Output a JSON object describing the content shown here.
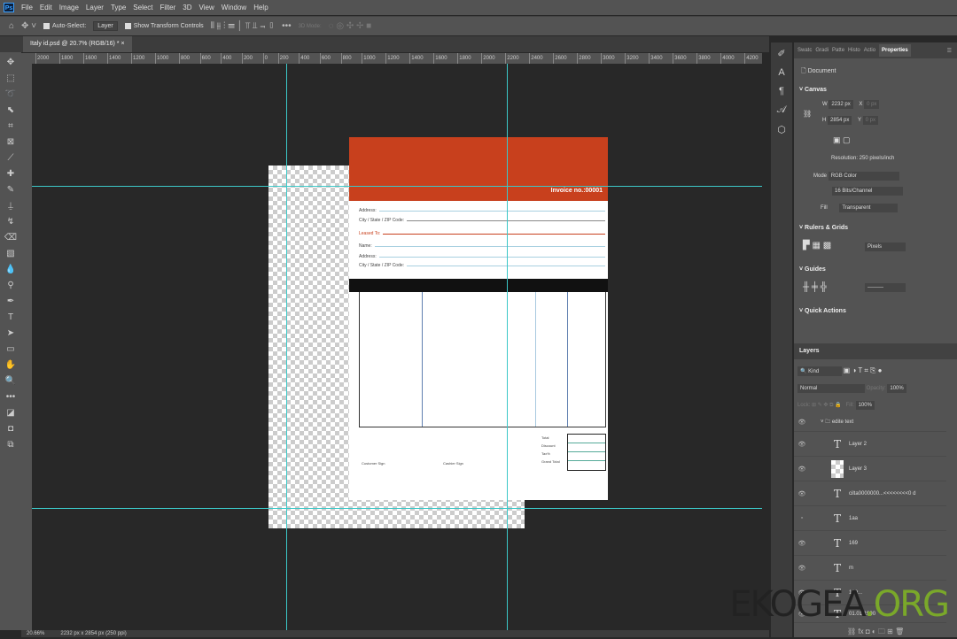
{
  "menu": [
    "File",
    "Edit",
    "Image",
    "Layer",
    "Type",
    "Select",
    "Filter",
    "3D",
    "View",
    "Window",
    "Help"
  ],
  "options": {
    "auto_select": "Auto-Select:",
    "layer_select": "Layer",
    "show_transform": "Show Transform Controls",
    "mode_3d": "3D Mode:"
  },
  "tab": {
    "title": "Italy id.psd @ 20.7% (RGB/16) *",
    "close": "×"
  },
  "ruler_ticks": [
    "2000",
    "1800",
    "1600",
    "1400",
    "1200",
    "1000",
    "800",
    "600",
    "400",
    "200",
    "0",
    "200",
    "400",
    "600",
    "800",
    "1000",
    "1200",
    "1400",
    "1600",
    "1800",
    "2000",
    "2200",
    "2400",
    "2600",
    "2800",
    "3000",
    "3200",
    "3400",
    "3600",
    "3800",
    "4000",
    "4200"
  ],
  "document": {
    "invoice_no": "Invoice no.:00001",
    "address": "Address:",
    "city": "City / State / ZIP Code:",
    "leased_to": "Leased To:",
    "name": "Name:",
    "address2": "Address:",
    "city2": "City / State / ZIP Code:",
    "total": "Total",
    "discount": "Discount",
    "tax": "Tax%",
    "grand_total": "Grand Total",
    "customer_sign": "Customer Sign",
    "cashier_sign": "Cashier Sign",
    "header_color": "#c8401d"
  },
  "status": {
    "zoom": "20.66%",
    "info": "2232 px x 2854 px (250 ppi)"
  },
  "panel": {
    "tabs": [
      "Swatc",
      "Gradi",
      "Patte",
      "Histo",
      "Actio",
      "Properties"
    ],
    "document": "Document",
    "canvas": "Canvas",
    "w_label": "W",
    "w": "2232 px",
    "h_label": "H",
    "h": "2854 px",
    "x_label": "X",
    "x": "0 px",
    "y_label": "Y",
    "y": "0 px",
    "resolution": "Resolution: 250 pixels/inch",
    "mode_label": "Mode",
    "mode": "RGB Color",
    "depth": "16 Bits/Channel",
    "fill_label": "Fill",
    "fill": "Transparent",
    "rulers": "Rulers & Grids",
    "units": "Pixels",
    "guides": "Guides",
    "quick_actions": "Quick Actions"
  },
  "layers": {
    "title": "Layers",
    "kind": "Kind",
    "blend": "Normal",
    "opacity_label": "Opacity:",
    "opacity": "100%",
    "lock_label": "Lock:",
    "fill_label": "Fill:",
    "fill": "100%",
    "group": "edite text",
    "items": [
      "Layer 2",
      "Layer 3",
      "cilta0000000...<<<<<<<<0 d",
      "1aa",
      "169",
      "m",
      "129...",
      "01.01.1990"
    ]
  },
  "watermark": {
    "a": "EKOGEA",
    "b": ".ORG"
  }
}
